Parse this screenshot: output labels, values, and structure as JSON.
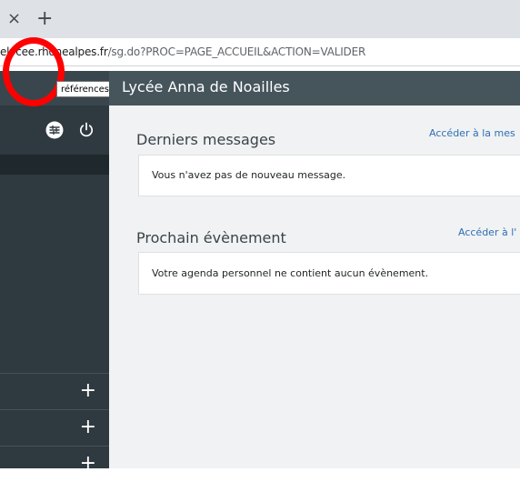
{
  "browser": {
    "tab_close": "×",
    "new_tab": "+",
    "url_host": "elycee.rhonealpes.fr",
    "url_path": "/sg.do?PROC=PAGE_ACCUEIL&ACTION=VALIDER"
  },
  "sidebar": {
    "settings_icon": "sliders-icon",
    "power_icon": "power-icon",
    "tooltip": "Préférences",
    "tooltip_visible": "références",
    "items": [
      {
        "icon": "+"
      },
      {
        "icon": "+"
      },
      {
        "icon": "+"
      }
    ]
  },
  "header": {
    "title": "Lycée Anna de Noailles"
  },
  "messages": {
    "title": "Derniers messages",
    "link": "Accéder à la mes",
    "text": "Vous n'avez pas de nouveau message."
  },
  "events": {
    "title": "Prochain évènement",
    "link": "Accéder à l'",
    "text": "Votre agenda personnel ne contient aucun évènement."
  },
  "colors": {
    "sidebar": "#2e3940",
    "header": "#46545c",
    "link": "#2f6fb5",
    "annotation": "#ff0000"
  }
}
